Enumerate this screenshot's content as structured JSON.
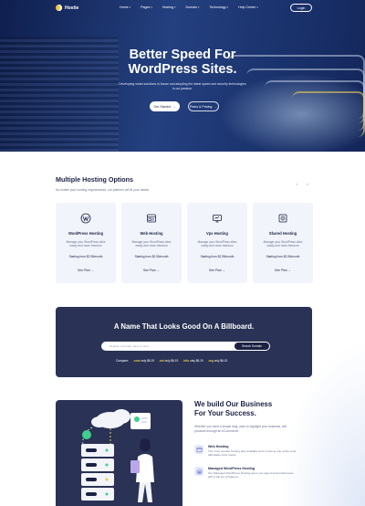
{
  "nav": {
    "brand": "Hostie",
    "items": [
      {
        "label": "Home"
      },
      {
        "label": "Pages"
      },
      {
        "label": "Hosting"
      },
      {
        "label": "Domain"
      },
      {
        "label": "Technology"
      },
      {
        "label": "Help Center"
      }
    ],
    "login_label": "Login"
  },
  "hero": {
    "title_line1": "Better Speed For",
    "title_line2": "WordPress Sites.",
    "subtitle": "Developing smart solutions in-house and adopting the latest speed and security technologies is our passion.",
    "primary_button": "Get Started",
    "secondary_button": "Plans & Pricing"
  },
  "hosting": {
    "title": "Multiple Hosting Options",
    "subtitle": "No matter your hosting requirements, our platform will fit your needs.",
    "cards": [
      {
        "title": "WordPress Hosting",
        "desc": "Manage your WordPress sites easily and more freedom",
        "price": "Starting from $2.95/month",
        "link": "See Plan",
        "icon": "wordpress-icon"
      },
      {
        "title": "Web Hosting",
        "desc": "Manage your WordPress sites easily and more freedom",
        "price": "Starting from $2.95/month",
        "link": "See Plan",
        "icon": "web-hosting-icon"
      },
      {
        "title": "Vps Hosting",
        "desc": "Manage your WordPress sites easily and more freedom",
        "price": "Starting from $2.95/month",
        "link": "See Plan",
        "icon": "vps-icon"
      },
      {
        "title": "Shared Hosting",
        "desc": "Manage your WordPress sites easily and more freedom",
        "price": "Starting from $2.95/month",
        "link": "See Plan",
        "icon": "shared-hosting-icon"
      }
    ]
  },
  "domain": {
    "title": "A Name That Looks Good On A Billboard.",
    "placeholder": "Register a domain name to start",
    "button": "Search Domain",
    "compare_label": "Compare:",
    "tlds": [
      {
        "ext": ".com",
        "price": "only $6.19"
      },
      {
        "ext": ".net",
        "price": "only $6.19"
      },
      {
        "ext": ".info",
        "price": "only $6.19"
      },
      {
        "ext": ".org",
        "price": "only $6.19"
      }
    ]
  },
  "build": {
    "title_line1": "We build Our Business",
    "title_line2": "For Your Success.",
    "desc": "Whether you need a simple blog, want to highlight your business, sell products through an eCommerce.",
    "features": [
      {
        "title": "Web Hosting",
        "desc": "The most popular hosting plan available and comes at one of the most affordable price points.",
        "icon": "web-hosting-icon"
      },
      {
        "title": "Managed WordPress Hosting",
        "desc": "Our Managed WordPress Hosting gives you speed and performance with a full set of features.",
        "icon": "wordpress-hosting-icon"
      }
    ]
  },
  "colors": {
    "navy": "#1c2143",
    "panel": "#2a3355",
    "accent": "#f5c542",
    "card_bg": "#f1f4fb"
  }
}
